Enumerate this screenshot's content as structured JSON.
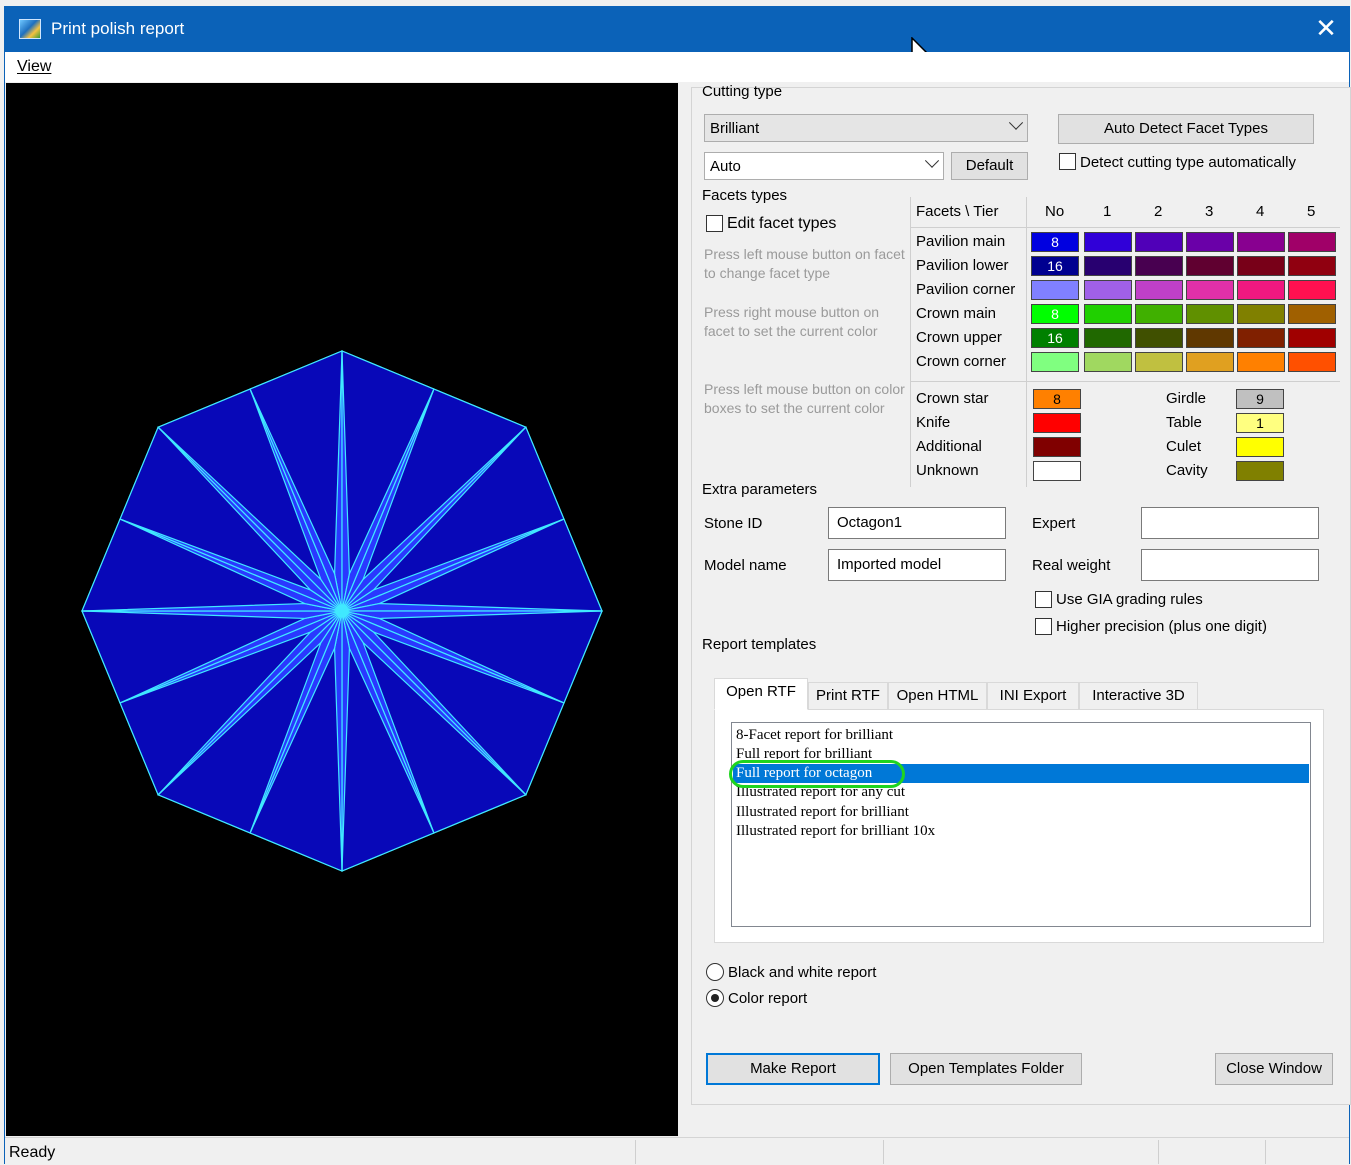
{
  "window": {
    "title": "Print polish report"
  },
  "menu": {
    "view": "View"
  },
  "cutting_type": {
    "label": "Cutting type",
    "type_value": "Brilliant",
    "mode_value": "Auto",
    "default_button": "Default",
    "auto_detect_button": "Auto Detect Facet Types",
    "detect_auto_checkbox": "Detect cutting type automatically"
  },
  "facets": {
    "label": "Facets types",
    "edit_checkbox": "Edit facet types",
    "hint1": "Press left mouse button on facet to change facet type",
    "hint2": "Press right mouse button on facet to set the current color",
    "hint3": "Press left mouse button on color boxes to set the current color",
    "header": {
      "corner": "Facets \\ Tier",
      "cols": [
        "No",
        "1",
        "2",
        "3",
        "4",
        "5"
      ]
    },
    "rows": [
      {
        "name": "Pavilion main",
        "no": "8",
        "colors": [
          "#0000e0",
          "#3000d8",
          "#5000b8",
          "#6a00a8",
          "#880090",
          "#a00068"
        ]
      },
      {
        "name": "Pavilion lower",
        "no": "16",
        "colors": [
          "#000090",
          "#280070",
          "#480050",
          "#600030",
          "#780018",
          "#900010"
        ]
      },
      {
        "name": "Pavilion corner",
        "no": "",
        "colors": [
          "#8080ff",
          "#a060e8",
          "#c040c8",
          "#e030a8",
          "#f01880",
          "#ff1050"
        ]
      },
      {
        "name": "Crown main",
        "no": "8",
        "colors": [
          "#00ff00",
          "#20d000",
          "#40b000",
          "#609000",
          "#808000",
          "#a06000"
        ]
      },
      {
        "name": "Crown upper",
        "no": "16",
        "colors": [
          "#008000",
          "#206800",
          "#405000",
          "#603800",
          "#802000",
          "#a00000"
        ]
      },
      {
        "name": "Crown corner",
        "no": "",
        "colors": [
          "#80ff80",
          "#a0d860",
          "#c0c040",
          "#e0a020",
          "#ff8000",
          "#ff5000"
        ]
      }
    ],
    "specials_left": [
      {
        "name": "Crown star",
        "value": "8",
        "color": "#ff8000"
      },
      {
        "name": "Knife",
        "value": "",
        "color": "#ff0000"
      },
      {
        "name": "Additional",
        "value": "",
        "color": "#800000"
      },
      {
        "name": "Unknown",
        "value": "",
        "color": "#ffffff"
      }
    ],
    "specials_right": [
      {
        "name": "Girdle",
        "value": "9",
        "color": "#c0c0c0"
      },
      {
        "name": "Table",
        "value": "1",
        "color": "#ffff80"
      },
      {
        "name": "Culet",
        "value": "",
        "color": "#ffff00"
      },
      {
        "name": "Cavity",
        "value": "",
        "color": "#808000"
      }
    ]
  },
  "extra": {
    "label": "Extra parameters",
    "stone_id_label": "Stone ID",
    "stone_id_value": "Octagon1",
    "model_name_label": "Model name",
    "model_name_value": "Imported model",
    "expert_label": "Expert",
    "expert_value": "",
    "real_weight_label": "Real weight",
    "real_weight_value": "",
    "gia_checkbox": "Use GIA grading rules",
    "precision_checkbox": "Higher precision (plus one digit)"
  },
  "templates": {
    "label": "Report templates",
    "tabs": [
      "Open RTF",
      "Print RTF",
      "Open HTML",
      "INI Export",
      "Interactive 3D"
    ],
    "items": [
      "8-Facet report for brilliant",
      "Full report for brilliant",
      "Full report for octagon",
      "Illustrated report for any cut",
      "Illustrated report for brilliant",
      "Illustrated report for brilliant 10x"
    ],
    "selected_index": 2
  },
  "report_mode": {
    "bw": "Black and white report",
    "color": "Color report",
    "selected": "color"
  },
  "buttons": {
    "make": "Make Report",
    "open_folder": "Open Templates Folder",
    "close": "Close Window"
  },
  "status": {
    "text": "Ready"
  },
  "colors": {
    "titlebar": "#0b62b8",
    "selection": "#0078d7",
    "highlight": "#1fd41f",
    "facet_light": "#2a38ff",
    "facet_dark": "#0808b8",
    "edge": "#40e8ff"
  },
  "icons": {
    "app": "app-icon",
    "close": "close-icon",
    "cursor": "mouse-cursor-icon",
    "dropdown": "chevron-down-icon"
  }
}
